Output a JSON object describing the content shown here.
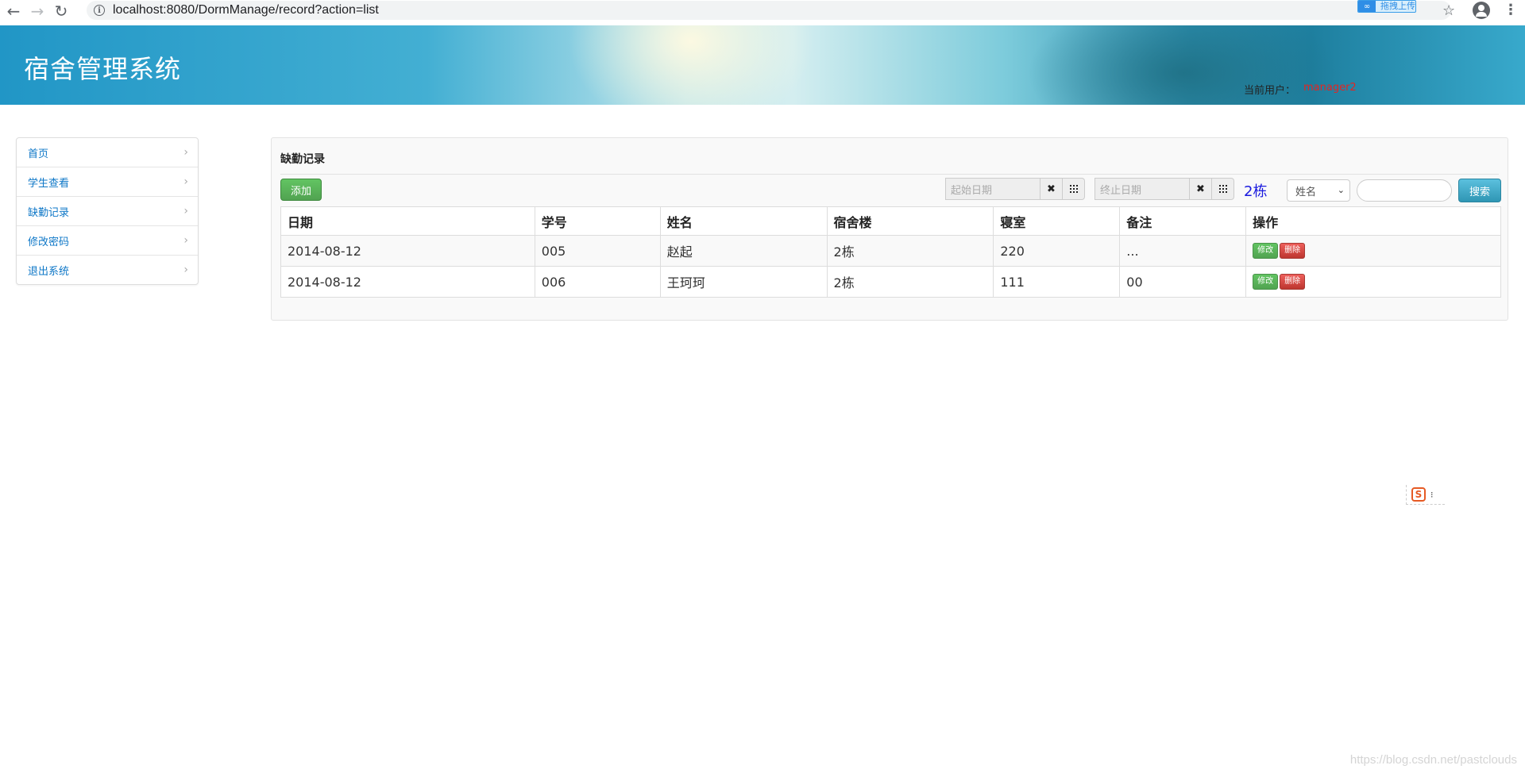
{
  "browser": {
    "url": "localhost:8080/DormManage/record?action=list",
    "extension_label": "拖拽上传"
  },
  "header": {
    "title": "宿舍管理系统",
    "user_label": "当前用户：",
    "user_name": "manager2"
  },
  "sidebar": {
    "items": [
      {
        "label": "首页"
      },
      {
        "label": "学生查看"
      },
      {
        "label": "缺勤记录"
      },
      {
        "label": "修改密码"
      },
      {
        "label": "退出系统"
      }
    ]
  },
  "main": {
    "panel_title": "缺勤记录",
    "add_button": "添加",
    "start_date_placeholder": "起始日期",
    "end_date_placeholder": "终止日期",
    "clear_glyph": "✖",
    "building": "2栋",
    "search_field_selected": "姓名",
    "search_button": "搜索",
    "table": {
      "headers": [
        "日期",
        "学号",
        "姓名",
        "宿舍楼",
        "寝室",
        "备注",
        "操作"
      ],
      "rows": [
        {
          "date": "2014-08-12",
          "student_no": "005",
          "name": "赵起",
          "building": "2栋",
          "room": "220",
          "note": "...",
          "edit": "修改",
          "delete": "删除"
        },
        {
          "date": "2014-08-12",
          "student_no": "006",
          "name": "王珂珂",
          "building": "2栋",
          "room": "111",
          "note": "00",
          "edit": "修改",
          "delete": "删除"
        }
      ]
    }
  },
  "watermark": "https://blog.csdn.net/pastclouds",
  "colors": {
    "link_blue": "#0e77c7",
    "success_green": "#51a351",
    "danger_red": "#bd362f",
    "info_blue": "#2f96b4",
    "building_blue": "#1a1adf",
    "user_red": "#e52421"
  }
}
